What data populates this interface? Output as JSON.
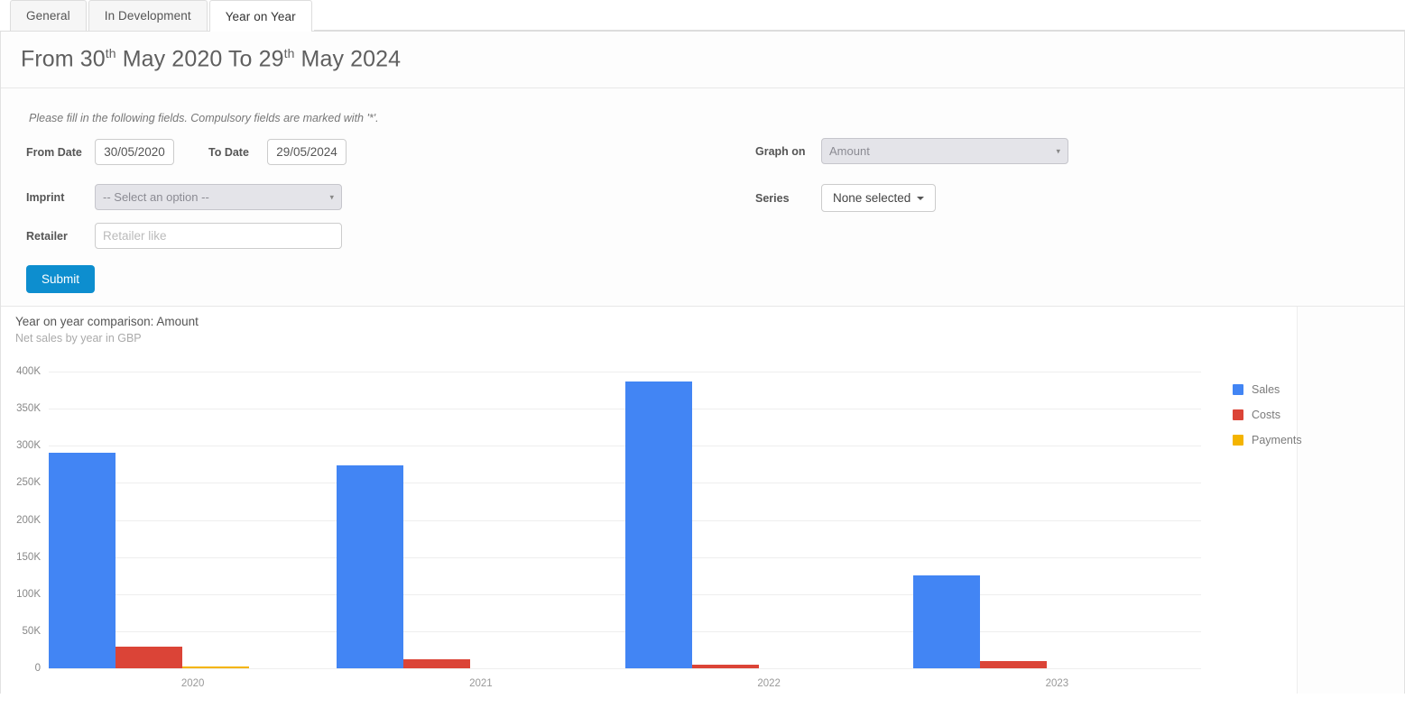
{
  "tabs": [
    {
      "label": "General",
      "active": false
    },
    {
      "label": "In Development",
      "active": false
    },
    {
      "label": "Year on Year",
      "active": true
    }
  ],
  "header": {
    "prefix": "From",
    "from_day": "30",
    "from_ord": "th",
    "from_rest": "May 2020 To",
    "to_day": "29",
    "to_ord": "th",
    "to_rest": "May 2024"
  },
  "form": {
    "note": "Please fill in the following fields. Compulsory fields are marked with '*'.",
    "from_date_label": "From Date",
    "from_date_value": "30/05/2020",
    "to_date_label": "To Date",
    "to_date_value": "29/05/2024",
    "imprint_label": "Imprint",
    "imprint_value": "-- Select an option --",
    "retailer_label": "Retailer",
    "retailer_value": "",
    "retailer_placeholder": "Retailer like",
    "graph_on_label": "Graph on",
    "graph_on_value": "Amount",
    "series_label": "Series",
    "series_value": "None selected",
    "submit_label": "Submit"
  },
  "chart_data": {
    "type": "bar",
    "title": "Year on year comparison: Amount",
    "subtitle": "Net sales by year in GBP",
    "xlabel": "",
    "ylabel": "",
    "ylim": [
      0,
      400000
    ],
    "ytick_values": [
      0,
      50000,
      100000,
      150000,
      200000,
      250000,
      300000,
      350000,
      400000
    ],
    "ytick_labels": [
      "0",
      "50K",
      "100K",
      "150K",
      "200K",
      "250K",
      "300K",
      "350K",
      "400K"
    ],
    "grid": true,
    "legend_position": "right",
    "categories": [
      "2020",
      "2021",
      "2022",
      "2023"
    ],
    "series": [
      {
        "name": "Sales",
        "color": "#4285F4",
        "values": [
          290000,
          273000,
          387000,
          125000
        ]
      },
      {
        "name": "Costs",
        "color": "#DB4437",
        "values": [
          29000,
          12000,
          5000,
          10000
        ]
      },
      {
        "name": "Payments",
        "color": "#F4B400",
        "values": [
          2000,
          0,
          0,
          0
        ]
      }
    ]
  }
}
